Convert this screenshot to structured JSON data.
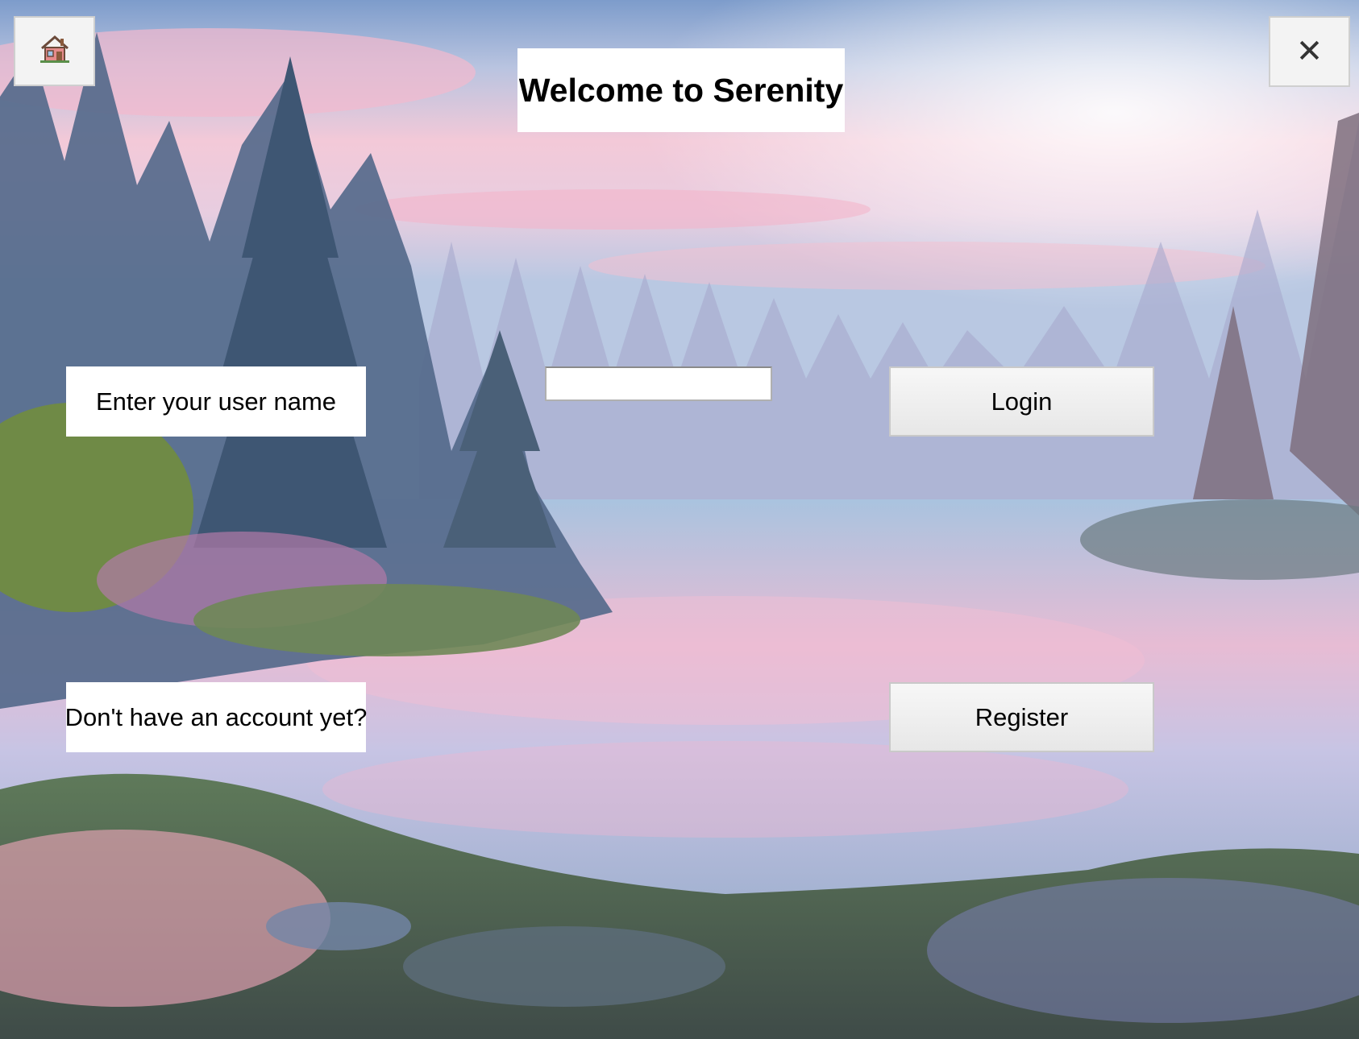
{
  "window": {
    "title": "Welcome to Serenity",
    "background": "misty-forest-lake-sunrise"
  },
  "toolbar": {
    "home_icon": "house-icon",
    "close_icon": "close-icon",
    "close_glyph": "✕"
  },
  "login": {
    "username_label": "Enter your user name",
    "username_value": "",
    "login_button": "Login"
  },
  "register": {
    "prompt": "Don't have an account yet?",
    "register_button": "Register"
  },
  "colors": {
    "box_bg": "#ffffff",
    "button_bg": "#ececec",
    "text": "#000000"
  }
}
